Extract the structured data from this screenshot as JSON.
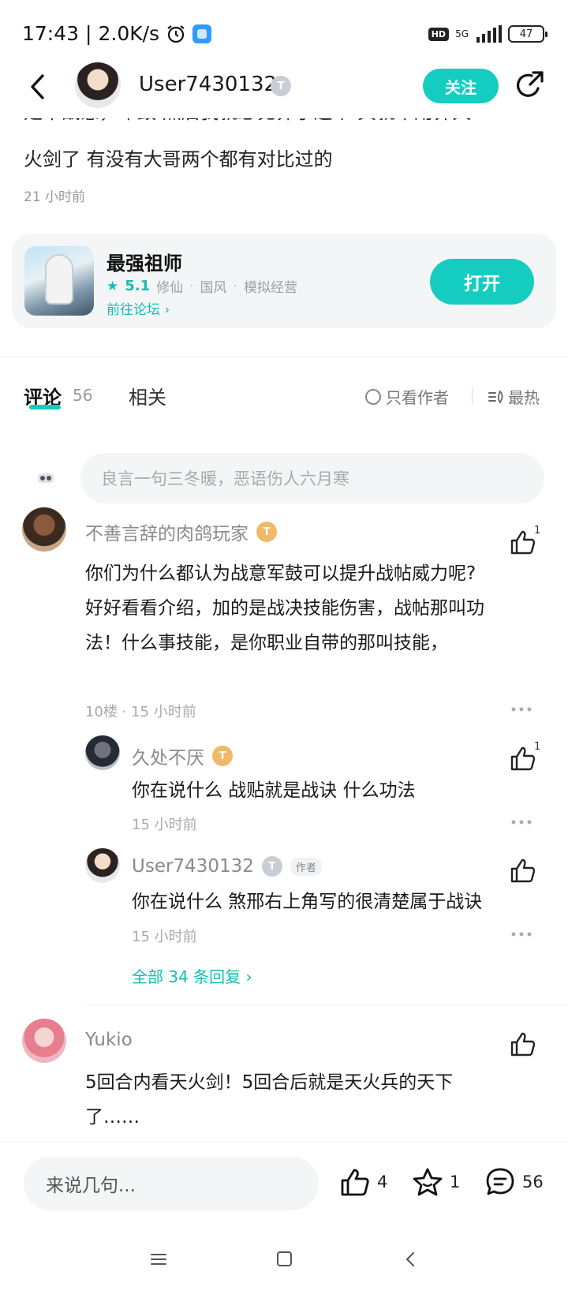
{
  "status_bar": {
    "time": "17:43",
    "speed": "2.0K/s",
    "network": "5G",
    "hd": "HD",
    "battery": "47"
  },
  "header": {
    "username": "User7430132",
    "badge": "T",
    "follow_label": "关注"
  },
  "post": {
    "cut_line": "是帝战意，军鼓 然后我就想觉养了这个 其就不用养天",
    "line": "火剑了  有没有大哥两个都有对比过的",
    "time": "21 小时前"
  },
  "game_card": {
    "name": "最强祖师",
    "rating": "5.1",
    "tags": [
      "修仙",
      "国风",
      "模拟经营"
    ],
    "forum_link": "前往论坛 ›",
    "open_label": "打开"
  },
  "tabs": {
    "comments_label": "评论",
    "comments_count": "56",
    "related_label": "相关",
    "author_only_label": "只看作者",
    "sort_label": "最热"
  },
  "comment_input": {
    "placeholder": "良言一句三冬暖，恶语伤人六月寒"
  },
  "comments": [
    {
      "user": "不善言辞的肉鸽玩家",
      "badge": "T",
      "lines": [
        "你们为什么都认为战意军鼓可以提升战帖威力呢?",
        "好好看看介绍，加的是战决技能伤害，战帖那叫功",
        "法！什么事技能，是你职业自带的那叫技能，"
      ],
      "meta": "10楼 · 15 小时前",
      "likes": "1",
      "replies": [
        {
          "user": "久处不厌",
          "badge": "T",
          "text": "你在说什么 战贴就是战诀 什么功法",
          "time": "15 小时前",
          "likes": "1"
        },
        {
          "user": "User7430132",
          "badge": "T",
          "author_tag": "作者",
          "text": "你在说什么 煞邢右上角写的很清楚属于战诀",
          "time": "15 小时前"
        }
      ],
      "all_replies": "全部 34 条回复 ›"
    },
    {
      "user": "Yukio",
      "lines": [
        "5回合内看天火剑！5回合后就是天火兵的天下",
        "了……"
      ]
    }
  ],
  "bottom_bar": {
    "input_placeholder": "来说几句...",
    "likes": "4",
    "favorites": "1",
    "comments": "56"
  },
  "colors": {
    "accent": "#14cdc0",
    "badge_gold": "#efb968",
    "badge_grey": "#c9ced6"
  }
}
